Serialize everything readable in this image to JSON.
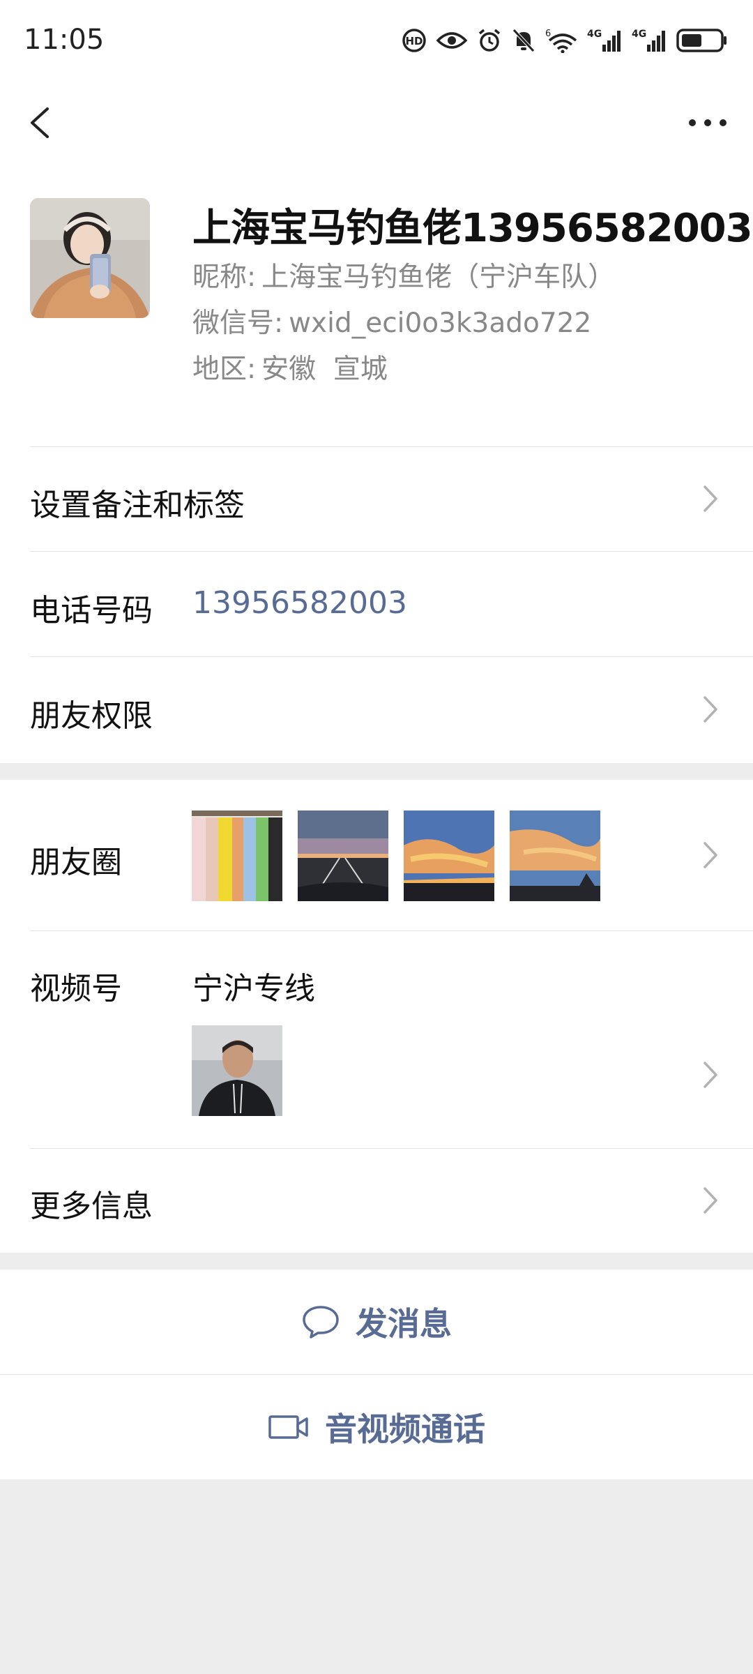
{
  "status_bar": {
    "time": "11:05",
    "icons": [
      "hd-call-icon",
      "eye-icon",
      "alarm-icon",
      "mute-icon",
      "wifi-icon",
      "signal-4g-icon",
      "signal-4g-icon",
      "battery-icon"
    ],
    "wifi_badge": "6",
    "net1": "4G",
    "net2": "4G"
  },
  "nav": {
    "back_icon": "chevron-left-icon",
    "more_icon": "more-dots-icon"
  },
  "profile": {
    "display_name": "上海宝马钓鱼佬13956582003",
    "nickname_label": "昵称:",
    "nickname": "上海宝马钓鱼佬（宁沪车队）",
    "wechat_id_label": "微信号:",
    "wechat_id": "wxid_eci0o3k3ado722",
    "region_label": "地区:",
    "region": "安徽  宣城",
    "gender_icon": "person-icon"
  },
  "rows": {
    "remark_label": "设置备注和标签",
    "phone_label": "电话号码",
    "phone_value": "13956582003",
    "permission_label": "朋友权限",
    "moments_label": "朋友圈",
    "channels_label": "视频号",
    "channel_name": "宁沪专线",
    "more_info_label": "更多信息"
  },
  "actions": {
    "message_label": "发消息",
    "call_label": "音视频通话"
  },
  "colors": {
    "link": "#576b95",
    "background": "#ededed",
    "divider": "#e3e3e3"
  }
}
